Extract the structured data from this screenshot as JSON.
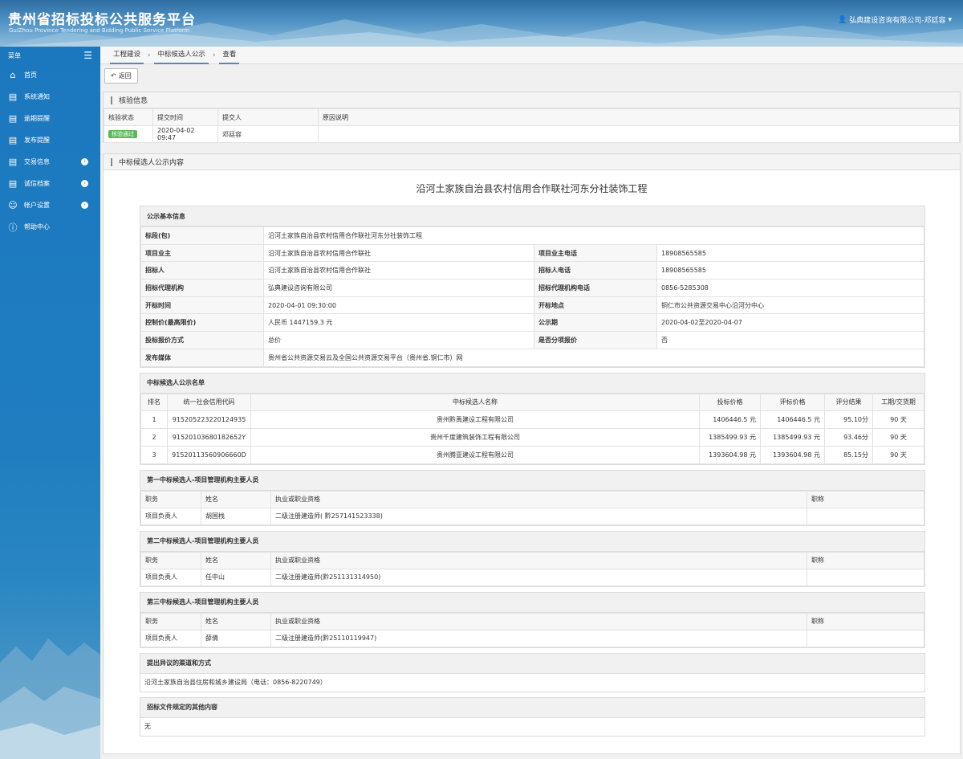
{
  "header": {
    "title": "贵州省招标投标公共服务平台",
    "subtitle": "GuiZhou Province Tendering and Bidding Public Service Platform",
    "user": "弘典建设咨询有限公司-邓廷容"
  },
  "sidebar": {
    "menu_label": "菜单",
    "items": [
      {
        "label": "首页",
        "icon": "home-icon",
        "has_arrow": false
      },
      {
        "label": "系统通知",
        "icon": "monitor-icon",
        "has_arrow": false
      },
      {
        "label": "逾期提醒",
        "icon": "list-icon",
        "has_arrow": false
      },
      {
        "label": "发布提醒",
        "icon": "list-icon",
        "has_arrow": false
      },
      {
        "label": "交易信息",
        "icon": "list-icon",
        "has_arrow": true
      },
      {
        "label": "诚信档案",
        "icon": "document-icon",
        "has_arrow": true
      },
      {
        "label": "帐户设置",
        "icon": "user-icon",
        "has_arrow": true
      },
      {
        "label": "帮助中心",
        "icon": "help-icon",
        "has_arrow": false
      }
    ]
  },
  "breadcrumb": [
    "工程建设",
    "中标候选人公示",
    "查看"
  ],
  "toolbar": {
    "back_label": "返回"
  },
  "verify": {
    "title": "核验信息",
    "headers": [
      "核验状态",
      "提交时间",
      "提交人",
      "原因说明"
    ],
    "status": "核验通过",
    "time": "2020-04-02 09:47",
    "submitter": "邓廷容",
    "reason": ""
  },
  "content": {
    "panel_title": "中标候选人公示内容",
    "doc_title": "沿河土家族自治县农村信用合作联社河东分社装饰工程",
    "basic": {
      "title": "公示基本信息",
      "section_label": "标段(包)",
      "section_value": "沿河土家族自治县农村信用合作联社河东分社装饰工程",
      "rows": [
        {
          "k1": "项目业主",
          "v1": "沿河土家族自治县农村信用合作联社",
          "k2": "项目业主电话",
          "v2": "18908565585"
        },
        {
          "k1": "招标人",
          "v1": "沿河土家族自治县农村信用合作联社",
          "k2": "招标人电话",
          "v2": "18908565585"
        },
        {
          "k1": "招标代理机构",
          "v1": "弘典建设咨询有限公司",
          "k2": "招标代理机构电话",
          "v2": "0856-5285308"
        },
        {
          "k1": "开标时间",
          "v1": "2020-04-01 09:30:00",
          "k2": "开标地点",
          "v2": "铜仁市公共资源交易中心沿河分中心"
        },
        {
          "k1": "控制价(最高限价)",
          "v1": "人民币 1447159.3 元",
          "k2": "公示期",
          "v2": "2020-04-02至2020-04-07"
        },
        {
          "k1": "投标报价方式",
          "v1": "总价",
          "k2": "是否分项报价",
          "v2": "否"
        }
      ],
      "media_label": "发布媒体",
      "media_value": "贵州省公共资源交易云及全国公共资源交易平台（贵州省.铜仁市）网"
    },
    "candidates": {
      "title": "中标候选人公示名单",
      "headers": [
        "排名",
        "统一社会信用代码",
        "中标候选人名称",
        "投标价格",
        "评标价格",
        "评分结果",
        "工期/交货期"
      ],
      "rows": [
        [
          "1",
          "915205223220124935",
          "贵州黔禹建设工程有限公司",
          "1406446.5 元",
          "1406446.5 元",
          "95.10分",
          "90 天"
        ],
        [
          "2",
          "91520103680182652Y",
          "贵州千度建筑装饰工程有限公司",
          "1385499.93 元",
          "1385499.93 元",
          "93.46分",
          "90 天"
        ],
        [
          "3",
          "91520113560906660D",
          "贵州腾亚建设工程有限公司",
          "1393604.98 元",
          "1393604.98 元",
          "85.15分",
          "90 天"
        ]
      ]
    },
    "staff": [
      {
        "title": "第一中标候选人-项目管理机构主要人员",
        "headers": [
          "职务",
          "姓名",
          "执业或职业资格",
          "职称"
        ],
        "row": [
          "项目负责人",
          "胡国栈",
          "二级注册建造师( 黔257141523338)",
          ""
        ]
      },
      {
        "title": "第二中标候选人-项目管理机构主要人员",
        "headers": [
          "职务",
          "姓名",
          "执业或职业资格",
          "职称"
        ],
        "row": [
          "项目负责人",
          "任中山",
          "二级注册建造师(黔251131314950)",
          ""
        ]
      },
      {
        "title": "第三中标候选人-项目管理机构主要人员",
        "headers": [
          "职务",
          "姓名",
          "执业或职业资格",
          "职称"
        ],
        "row": [
          "项目负责人",
          "薛倩",
          "二级注册建造师(黔25110119947)",
          ""
        ]
      }
    ],
    "objection": {
      "title": "提出异议的渠道和方式",
      "text": "沿河土家族自治县住房和城乡建设局（电话：0856-8220749）"
    },
    "other": {
      "title": "招标文件规定的其他内容",
      "text": "无"
    }
  }
}
